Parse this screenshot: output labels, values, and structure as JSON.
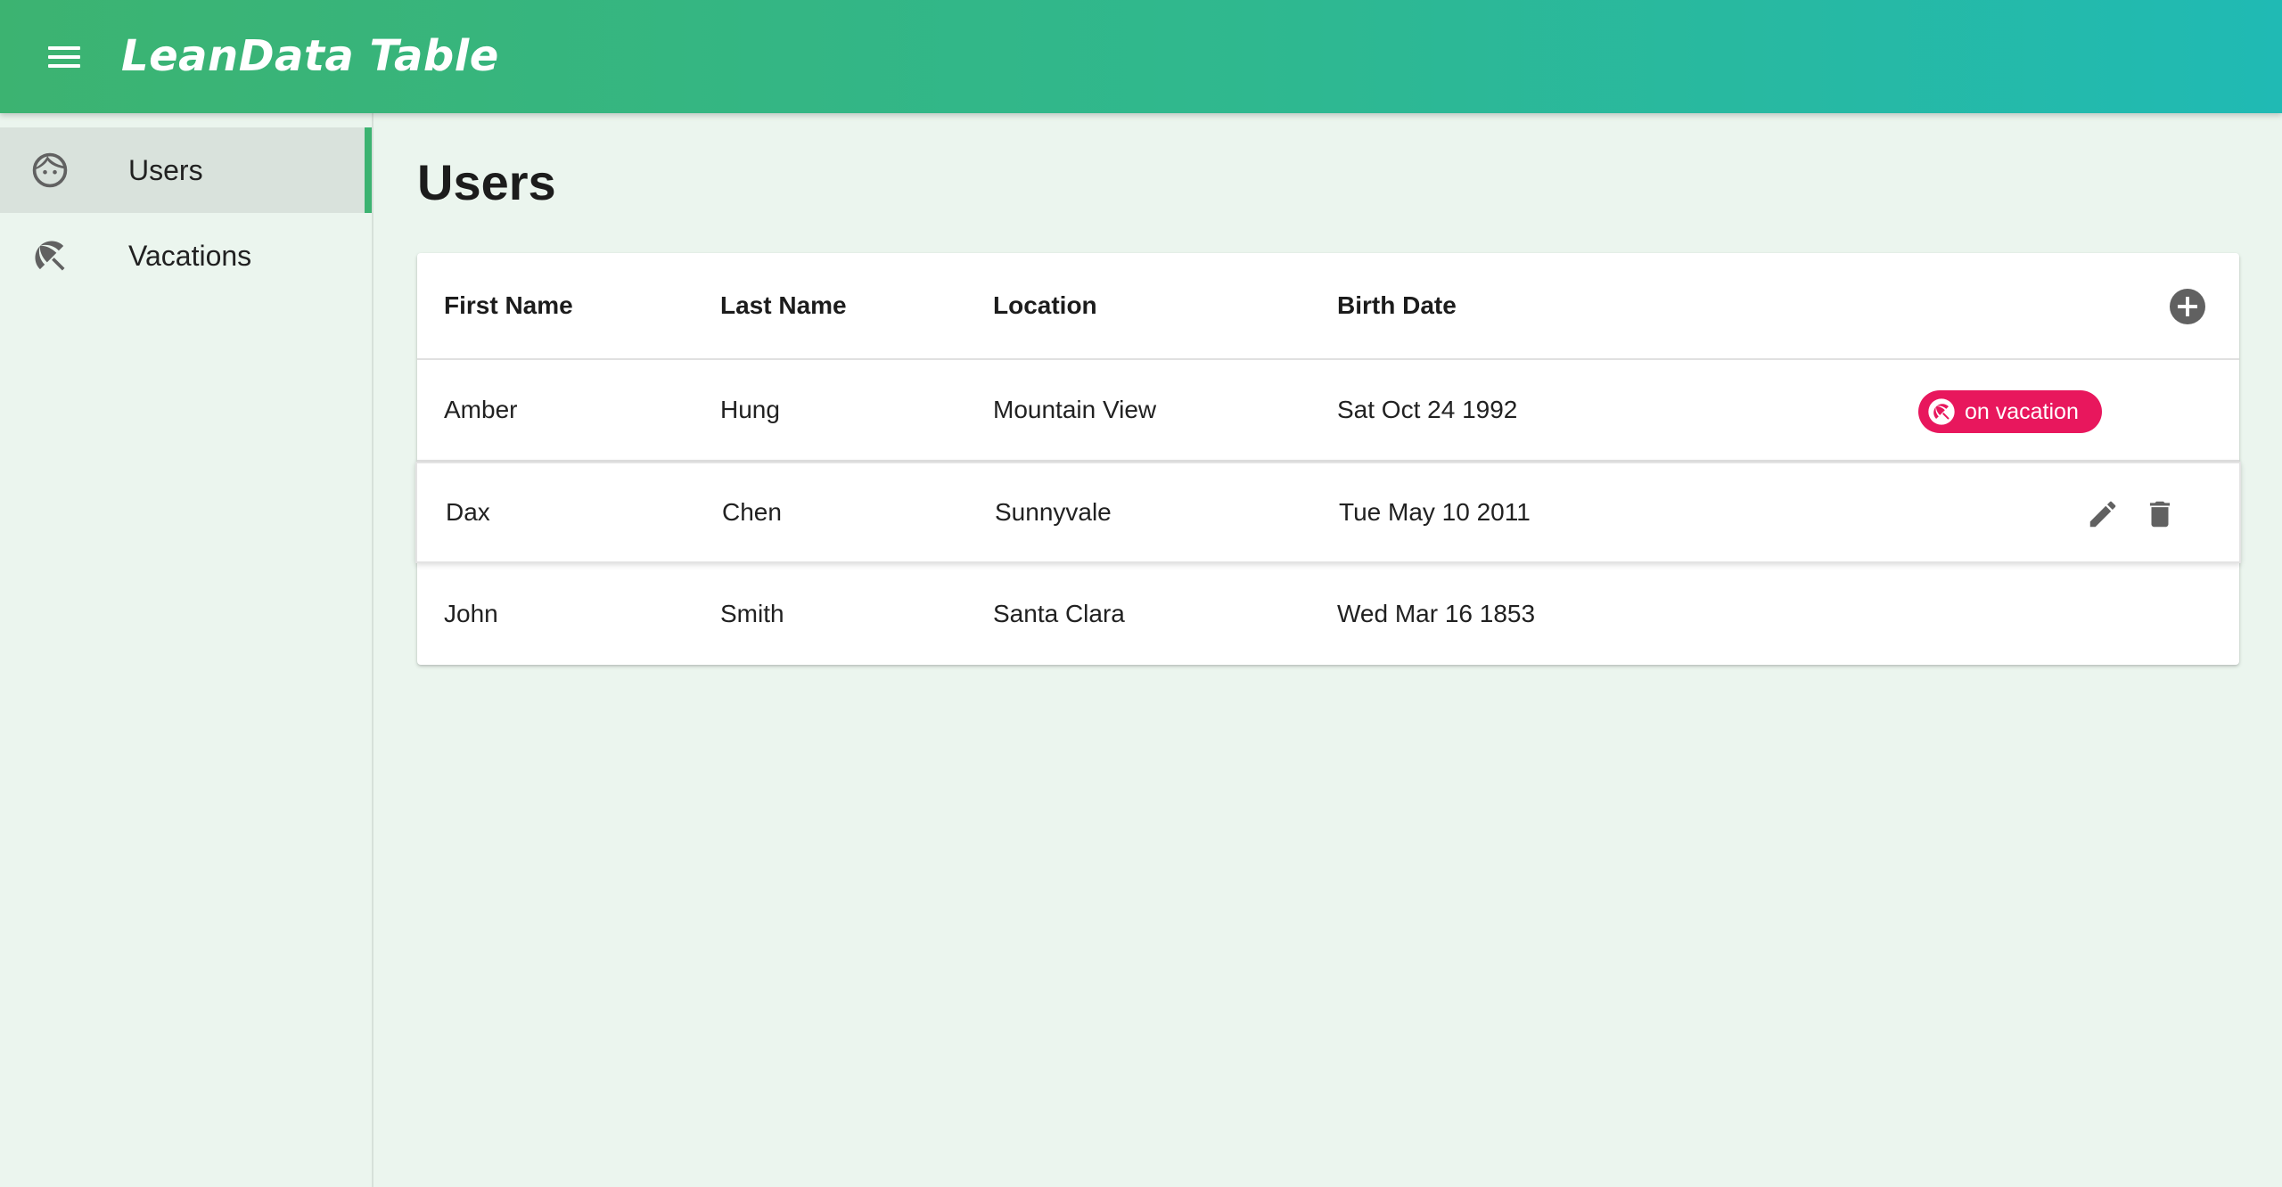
{
  "app": {
    "title": "LeanData Table",
    "menu_icon": "hamburger-menu-icon"
  },
  "sidebar": {
    "items": [
      {
        "label": "Users",
        "icon": "face-icon",
        "active": true
      },
      {
        "label": "Vacations",
        "icon": "beach-umbrella-icon",
        "active": false
      }
    ]
  },
  "main": {
    "page_title": "Users",
    "table": {
      "columns": [
        "First Name",
        "Last Name",
        "Location",
        "Birth Date"
      ],
      "add_icon": "add-circle-icon",
      "rows": [
        {
          "first_name": "Amber",
          "last_name": "Hung",
          "location": "Mountain View",
          "birth_date": "Sat Oct 24 1992",
          "badge": "on vacation"
        },
        {
          "first_name": "Dax",
          "last_name": "Chen",
          "location": "Sunnyvale",
          "birth_date": "Tue May 10 2011",
          "actions": [
            "edit-icon",
            "delete-icon"
          ]
        },
        {
          "first_name": "John",
          "last_name": "Smith",
          "location": "Santa Clara",
          "birth_date": "Wed Mar 16 1853"
        }
      ]
    }
  },
  "colors": {
    "appbar_gradient_start": "#3cb371",
    "appbar_gradient_end": "#20bab4",
    "accent": "#3cb371",
    "badge": "#e8175d",
    "background": "#ebf5ee",
    "icon_gray": "#616161"
  }
}
